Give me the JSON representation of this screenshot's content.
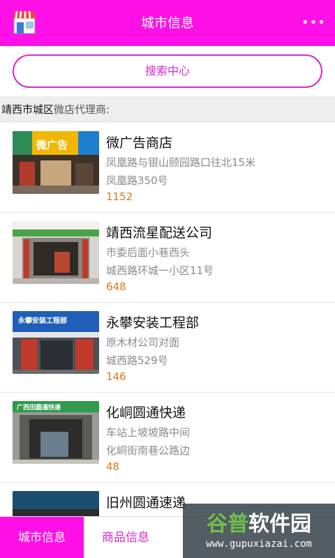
{
  "header": {
    "title": "城市信息",
    "more_glyph": "•••"
  },
  "search": {
    "label": "搜索中心"
  },
  "section": {
    "city": "靖西市城区",
    "suffix": "微店代理商:"
  },
  "shops": [
    {
      "name": "微广告商店",
      "addr1": "凤凰路与银山颐园路口往北15米",
      "addr2": "凤凰路350号",
      "count": "1152",
      "sign_text": "微广告"
    },
    {
      "name": "靖西流星配送公司",
      "addr1": "市委后面小巷西头",
      "addr2": "城西路环城一小区11号",
      "count": "648",
      "sign_text": ""
    },
    {
      "name": "永攀安装工程部",
      "addr1": "原木材公司对面",
      "addr2": "城西路529号",
      "count": "146",
      "sign_text": "永攀安装工程部"
    },
    {
      "name": "化峒圆通快递",
      "addr1": "车站上坡坡路中间",
      "addr2": "化峒街南巷公路边",
      "count": "48",
      "sign_text": "广西田圆通快递"
    },
    {
      "name": "旧州圆通速递",
      "addr1": "",
      "addr2": "",
      "count": "",
      "sign_text": ""
    }
  ],
  "tabs": [
    {
      "label": "城市信息"
    },
    {
      "label": "商品信息"
    }
  ],
  "watermark": {
    "title_green": "谷普",
    "title_rest": "软件园",
    "url": "www.gupuxiazai.com"
  },
  "colors": {
    "brand": "#ff10e8",
    "accent": "#d42ad0",
    "count": "#e0751a"
  }
}
